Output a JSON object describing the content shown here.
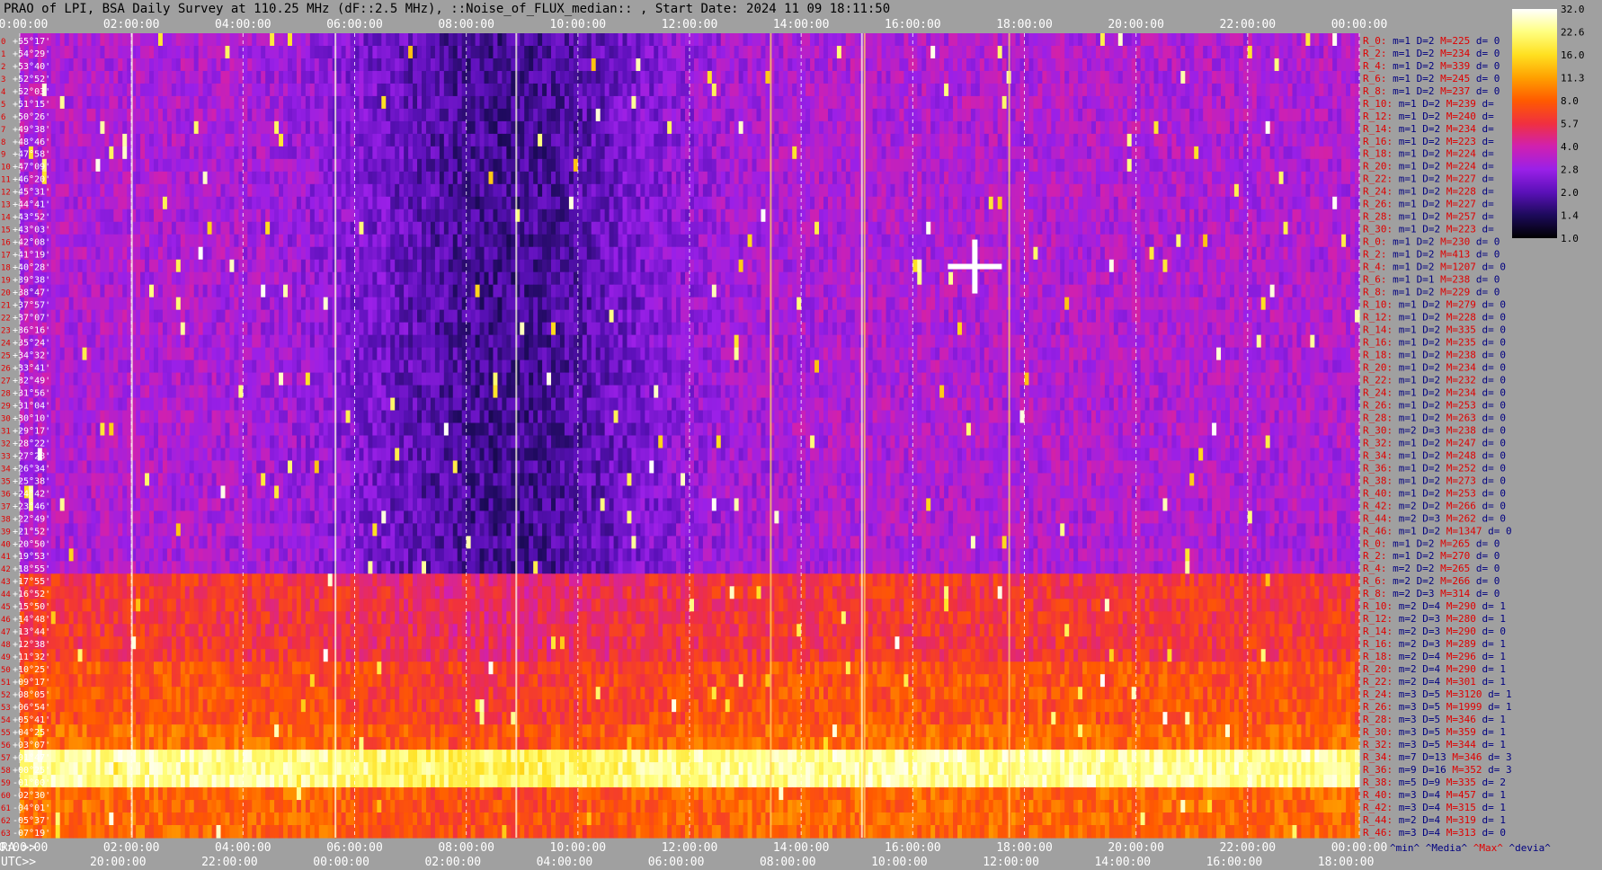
{
  "title": "PRAO of LPI, BSA Daily Survey at 110.25 MHz (dF::2.5 MHz), ::Noise_of_FLUX_median:: , Start Date: 2024 11 09 18:11:50",
  "chart_data": {
    "type": "heatmap",
    "title": "PRAO of LPI, BSA Daily Survey at 110.25 MHz (dF::2.5 MHz), ::Noise_of_FLUX_median:: , Start Date: 2024 11 09 18:11:50",
    "ra_axis_label": "RA >>",
    "utc_axis_label": "UTC>>",
    "ra_ticks_top": [
      "00:00:00",
      "02:00:00",
      "04:00:00",
      "06:00:00",
      "08:00:00",
      "10:00:00",
      "12:00:00",
      "14:00:00",
      "16:00:00",
      "18:00:00",
      "20:00:00",
      "22:00:00",
      "00:00:00"
    ],
    "ra_ticks_bottom": [
      "00:00:00",
      "02:00:00",
      "04:00:00",
      "06:00:00",
      "08:00:00",
      "10:00:00",
      "12:00:00",
      "14:00:00",
      "16:00:00",
      "18:00:00",
      "20:00:00",
      "22:00:00",
      "00:00:00"
    ],
    "utc_ticks": [
      "20:00:00",
      "22:00:00",
      "00:00:00",
      "02:00:00",
      "04:00:00",
      "06:00:00",
      "08:00:00",
      "10:00:00",
      "12:00:00",
      "14:00:00",
      "16:00:00",
      "18:00:00"
    ],
    "declinations": [
      "+55°17'",
      "+54°29'",
      "+53°40'",
      "+52°52'",
      "+52°03'",
      "+51°15'",
      "+50°26'",
      "+49°38'",
      "+48°46'",
      "+47°58'",
      "+47°09'",
      "+46°20'",
      "+45°31'",
      "+44°41'",
      "+43°52'",
      "+43°03'",
      "+42°08'",
      "+41°19'",
      "+40°28'",
      "+39°38'",
      "+38°47'",
      "+37°57'",
      "+37°07'",
      "+36°16'",
      "+35°24'",
      "+34°32'",
      "+33°41'",
      "+32°49'",
      "+31°56'",
      "+31°04'",
      "+30°10'",
      "+29°17'",
      "+28°22'",
      "+27°28'",
      "+26°34'",
      "+25°38'",
      "+24°42'",
      "+23°46'",
      "+22°49'",
      "+21°52'",
      "+20°50'",
      "+19°53'",
      "+18°55'",
      "+17°55'",
      "+16°52'",
      "+15°50'",
      "+14°48'",
      "+13°44'",
      "+12°38'",
      "+11°32'",
      "+10°25'",
      "+09°17'",
      "+08°05'",
      "+06°54'",
      "+05°41'",
      "+04°25'",
      "+03°07'",
      "+01°47'",
      "+00°25'",
      "-01°00'",
      "-02°30'",
      "-04°01'",
      "-05°37'",
      "-07°19'"
    ],
    "row_stats": [
      {
        "r": "R_0:",
        "m": "m=1",
        "D": "D=2",
        "M": "M=225",
        "d": "d= 0"
      },
      {
        "r": "R_2:",
        "m": "m=1",
        "D": "D=2",
        "M": "M=234",
        "d": "d= 0"
      },
      {
        "r": "R_4:",
        "m": "m=1",
        "D": "D=2",
        "M": "M=339",
        "d": "d= 0"
      },
      {
        "r": "R_6:",
        "m": "m=1",
        "D": "D=2",
        "M": "M=245",
        "d": "d= 0"
      },
      {
        "r": "R_8:",
        "m": "m=1",
        "D": "D=2",
        "M": "M=237",
        "d": "d= 0"
      },
      {
        "r": "R_10:",
        "m": "m=1",
        "D": "D=2",
        "M": "M=239",
        "d": "d="
      },
      {
        "r": "R_12:",
        "m": "m=1",
        "D": "D=2",
        "M": "M=240",
        "d": "d="
      },
      {
        "r": "R_14:",
        "m": "m=1",
        "D": "D=2",
        "M": "M=234",
        "d": "d="
      },
      {
        "r": "R_16:",
        "m": "m=1",
        "D": "D=2",
        "M": "M=223",
        "d": "d="
      },
      {
        "r": "R_18:",
        "m": "m=1",
        "D": "D=2",
        "M": "M=224",
        "d": "d="
      },
      {
        "r": "R_20:",
        "m": "m=1",
        "D": "D=2",
        "M": "M=224",
        "d": "d="
      },
      {
        "r": "R_22:",
        "m": "m=1",
        "D": "D=2",
        "M": "M=227",
        "d": "d="
      },
      {
        "r": "R_24:",
        "m": "m=1",
        "D": "D=2",
        "M": "M=228",
        "d": "d="
      },
      {
        "r": "R_26:",
        "m": "m=1",
        "D": "D=2",
        "M": "M=227",
        "d": "d="
      },
      {
        "r": "R_28:",
        "m": "m=1",
        "D": "D=2",
        "M": "M=257",
        "d": "d="
      },
      {
        "r": "R_30:",
        "m": "m=1",
        "D": "D=2",
        "M": "M=223",
        "d": "d="
      },
      {
        "r": "R_0:",
        "m": "m=1",
        "D": "D=2",
        "M": "M=230",
        "d": "d= 0"
      },
      {
        "r": "R_2:",
        "m": "m=1",
        "D": "D=2",
        "M": "M=413",
        "d": "d= 0"
      },
      {
        "r": "R_4:",
        "m": "m=1",
        "D": "D=2",
        "M": "M=1207",
        "d": "d= 0"
      },
      {
        "r": "R_6:",
        "m": "m=1",
        "D": "D=1",
        "M": "M=238",
        "d": "d= 0"
      },
      {
        "r": "R_8:",
        "m": "m=1",
        "D": "D=2",
        "M": "M=229",
        "d": "d= 0"
      },
      {
        "r": "R_10:",
        "m": "m=1",
        "D": "D=2",
        "M": "M=279",
        "d": "d= 0"
      },
      {
        "r": "R_12:",
        "m": "m=1",
        "D": "D=2",
        "M": "M=228",
        "d": "d= 0"
      },
      {
        "r": "R_14:",
        "m": "m=1",
        "D": "D=2",
        "M": "M=335",
        "d": "d= 0"
      },
      {
        "r": "R_16:",
        "m": "m=1",
        "D": "D=2",
        "M": "M=235",
        "d": "d= 0"
      },
      {
        "r": "R_18:",
        "m": "m=1",
        "D": "D=2",
        "M": "M=238",
        "d": "d= 0"
      },
      {
        "r": "R_20:",
        "m": "m=1",
        "D": "D=2",
        "M": "M=234",
        "d": "d= 0"
      },
      {
        "r": "R_22:",
        "m": "m=1",
        "D": "D=2",
        "M": "M=232",
        "d": "d= 0"
      },
      {
        "r": "R_24:",
        "m": "m=1",
        "D": "D=2",
        "M": "M=234",
        "d": "d= 0"
      },
      {
        "r": "R_26:",
        "m": "m=1",
        "D": "D=2",
        "M": "M=253",
        "d": "d= 0"
      },
      {
        "r": "R_28:",
        "m": "m=1",
        "D": "D=2",
        "M": "M=263",
        "d": "d= 0"
      },
      {
        "r": "R_30:",
        "m": "m=2",
        "D": "D=3",
        "M": "M=238",
        "d": "d= 0"
      },
      {
        "r": "R_32:",
        "m": "m=1",
        "D": "D=2",
        "M": "M=247",
        "d": "d= 0"
      },
      {
        "r": "R_34:",
        "m": "m=1",
        "D": "D=2",
        "M": "M=248",
        "d": "d= 0"
      },
      {
        "r": "R_36:",
        "m": "m=1",
        "D": "D=2",
        "M": "M=252",
        "d": "d= 0"
      },
      {
        "r": "R_38:",
        "m": "m=1",
        "D": "D=2",
        "M": "M=273",
        "d": "d= 0"
      },
      {
        "r": "R_40:",
        "m": "m=1",
        "D": "D=2",
        "M": "M=253",
        "d": "d= 0"
      },
      {
        "r": "R_42:",
        "m": "m=2",
        "D": "D=2",
        "M": "M=266",
        "d": "d= 0"
      },
      {
        "r": "R_44:",
        "m": "m=2",
        "D": "D=3",
        "M": "M=262",
        "d": "d= 0"
      },
      {
        "r": "R_46:",
        "m": "m=1",
        "D": "D=2",
        "M": "M=1347",
        "d": "d= 0"
      },
      {
        "r": "R_0:",
        "m": "m=1",
        "D": "D=2",
        "M": "M=265",
        "d": "d= 0"
      },
      {
        "r": "R_2:",
        "m": "m=1",
        "D": "D=2",
        "M": "M=270",
        "d": "d= 0"
      },
      {
        "r": "R_4:",
        "m": "m=2",
        "D": "D=2",
        "M": "M=265",
        "d": "d= 0"
      },
      {
        "r": "R_6:",
        "m": "m=2",
        "D": "D=2",
        "M": "M=266",
        "d": "d= 0"
      },
      {
        "r": "R_8:",
        "m": "m=2",
        "D": "D=3",
        "M": "M=314",
        "d": "d= 0"
      },
      {
        "r": "R_10:",
        "m": "m=2",
        "D": "D=4",
        "M": "M=290",
        "d": "d= 1"
      },
      {
        "r": "R_12:",
        "m": "m=2",
        "D": "D=3",
        "M": "M=280",
        "d": "d= 1"
      },
      {
        "r": "R_14:",
        "m": "m=2",
        "D": "D=3",
        "M": "M=290",
        "d": "d= 0"
      },
      {
        "r": "R_16:",
        "m": "m=2",
        "D": "D=3",
        "M": "M=289",
        "d": "d= 1"
      },
      {
        "r": "R_18:",
        "m": "m=2",
        "D": "D=4",
        "M": "M=296",
        "d": "d= 1"
      },
      {
        "r": "R_20:",
        "m": "m=2",
        "D": "D=4",
        "M": "M=290",
        "d": "d= 1"
      },
      {
        "r": "R_22:",
        "m": "m=2",
        "D": "D=4",
        "M": "M=301",
        "d": "d= 1"
      },
      {
        "r": "R_24:",
        "m": "m=3",
        "D": "D=5",
        "M": "M=3120",
        "d": "d= 1"
      },
      {
        "r": "R_26:",
        "m": "m=3",
        "D": "D=5",
        "M": "M=1999",
        "d": "d= 1"
      },
      {
        "r": "R_28:",
        "m": "m=3",
        "D": "D=5",
        "M": "M=346",
        "d": "d= 1"
      },
      {
        "r": "R_30:",
        "m": "m=3",
        "D": "D=5",
        "M": "M=359",
        "d": "d= 1"
      },
      {
        "r": "R_32:",
        "m": "m=3",
        "D": "D=5",
        "M": "M=344",
        "d": "d= 1"
      },
      {
        "r": "R_34:",
        "m": "m=7",
        "D": "D=13",
        "M": "M=346",
        "d": "d= 3"
      },
      {
        "r": "R_36:",
        "m": "m=9",
        "D": "D=16",
        "M": "M=352",
        "d": "d= 3"
      },
      {
        "r": "R_38:",
        "m": "m=5",
        "D": "D=9",
        "M": "M=335",
        "d": "d= 2"
      },
      {
        "r": "R_40:",
        "m": "m=3",
        "D": "D=4",
        "M": "M=457",
        "d": "d= 1"
      },
      {
        "r": "R_42:",
        "m": "m=3",
        "D": "D=4",
        "M": "M=315",
        "d": "d= 1"
      },
      {
        "r": "R_44:",
        "m": "m=2",
        "D": "D=4",
        "M": "M=319",
        "d": "d= 1"
      },
      {
        "r": "R_46:",
        "m": "m=3",
        "D": "D=4",
        "M": "M=313",
        "d": "d= 0"
      }
    ],
    "stats_footer": [
      "^min^",
      "^Media^",
      "^Max^",
      "^devia^"
    ],
    "colorbar_ticks": [
      "32.0",
      "22.6",
      "16.0",
      "11.3",
      "8.0",
      "5.7",
      "4.0",
      "2.8",
      "2.0",
      "1.4",
      "1.0"
    ],
    "colorbar_range": [
      1.0,
      32.0
    ],
    "colormap": [
      "#000000",
      "#1c0a5a",
      "#5a10b8",
      "#9a20e8",
      "#d020b0",
      "#f03040",
      "#ff5a00",
      "#ffa000",
      "#ffe020",
      "#ffff80",
      "#ffffff"
    ],
    "bright_band_dec": "+00°25'",
    "bright_source_ra": "20:00:00",
    "grid_lines": "dashed vertical at each RA tick"
  },
  "colors": {
    "background": "#a0a0a0",
    "stat_label": "#e00000",
    "stat_value": "#000080",
    "tick_text": "#ffffff",
    "axis_label": "#000000"
  }
}
